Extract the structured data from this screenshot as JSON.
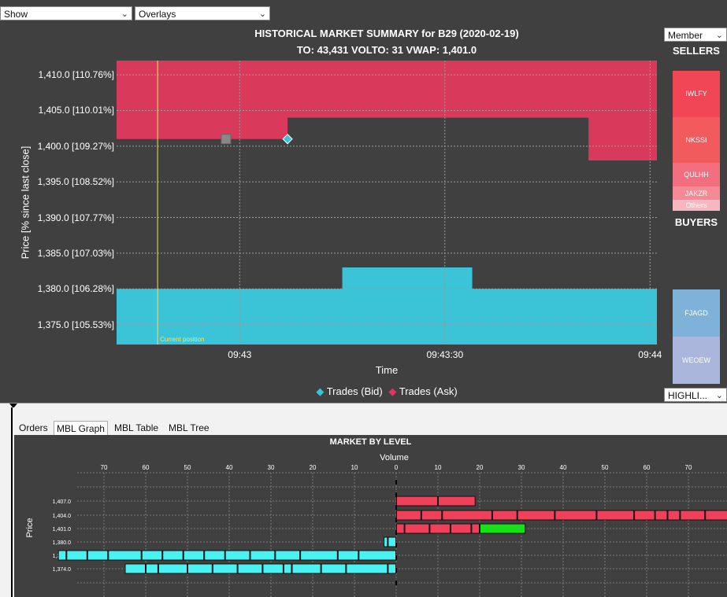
{
  "toolbar": {
    "show_label": "Show",
    "overlays_label": "Overlays"
  },
  "summary": {
    "title": "HISTORICAL MARKET SUMMARY for B29 (2020-02-19)",
    "subtitle": "TO: 43,431 VOLTO: 31 VWAP: 1,401.0",
    "ylabel": "Price [% since last close]",
    "xlabel": "Time",
    "current_position_label": "Current position",
    "legend_bid": "Trades (Bid)",
    "legend_ask": "Trades (Ask)"
  },
  "side_panel": {
    "member_label": "Member",
    "sellers_label": "SELLERS",
    "buyers_label": "BUYERS",
    "highlight_label": "HIGHLI...",
    "sellers": [
      {
        "name": "IWLFY",
        "share": 0.3,
        "color": "#f04656"
      },
      {
        "name": "NKSSI",
        "share": 0.3,
        "color": "#f25a5e"
      },
      {
        "name": "QULHH",
        "share": 0.15,
        "color": "#f36e7e"
      },
      {
        "name": "JAKZR",
        "share": 0.09,
        "color": "#f38a96"
      },
      {
        "name": "Others",
        "share": 0.07,
        "color": "#f7b7c0"
      }
    ],
    "buyers": [
      {
        "name": "FJAGD",
        "share": 0.5,
        "color": "#7fb2d8"
      },
      {
        "name": "WEOEW",
        "share": 0.5,
        "color": "#aab6dc"
      }
    ]
  },
  "tabs": [
    {
      "label": "Orders",
      "active": false
    },
    {
      "label": "MBL Graph",
      "active": true
    },
    {
      "label": "MBL Table",
      "active": false
    },
    {
      "label": "MBL Tree",
      "active": false
    }
  ],
  "chart_data": [
    {
      "type": "area",
      "title": "HISTORICAL MARKET SUMMARY for B29 (2020-02-19)",
      "subtitle": "TO: 43,431 VOLTO: 31 VWAP: 1,401.0",
      "xlabel": "Time",
      "ylabel": "Price [% since last close]",
      "xlim": [
        "09:42:42",
        "09:44:01"
      ],
      "ylim": [
        1372.2,
        1412.0
      ],
      "x_ticks": [
        "09:43",
        "09:43:30",
        "09:44"
      ],
      "y_ticks": [
        "1,410.0 [110.76%]",
        "1,405.0 [110.01%]",
        "1,400.0 [109.27%]",
        "1,395.0 [108.52%]",
        "1,390.0 [107.77%]",
        "1,385.0 [107.03%]",
        "1,380.0 [106.28%]",
        "1,375.0 [105.53%]"
      ],
      "y_tick_values": [
        1410,
        1405,
        1400,
        1395,
        1390,
        1385,
        1380,
        1375
      ],
      "grid": true,
      "legend": "bottom",
      "current_position_time": "09:42:48",
      "series": [
        {
          "name": "Trades (Bid)",
          "color": "#3bc3d8",
          "points": [
            [
              "09:42:42",
              1380.0
            ],
            [
              "09:43:15",
              1380.0
            ],
            [
              "09:43:15",
              1383.0
            ],
            [
              "09:43:34",
              1383.0
            ],
            [
              "09:43:34",
              1380.0
            ],
            [
              "09:44:01",
              1380.0
            ]
          ]
        },
        {
          "name": "Trades (Ask)",
          "color": "#d9395a",
          "points": [
            [
              "09:42:42",
              1401.0
            ],
            [
              "09:43:07",
              1401.0
            ],
            [
              "09:43:07",
              1404.0
            ],
            [
              "09:43:51",
              1404.0
            ],
            [
              "09:43:51",
              1398.0
            ],
            [
              "09:44:01",
              1398.0
            ]
          ]
        }
      ],
      "markers": [
        {
          "time": "09:42:58",
          "price": 1401.0,
          "shape": "square"
        },
        {
          "time": "09:43:07",
          "price": 1401.0,
          "shape": "diamond"
        }
      ]
    },
    {
      "type": "bar",
      "title": "MARKET BY LEVEL",
      "xlabel": "Volume",
      "ylabel": "Price",
      "xlim": [
        -76,
        76
      ],
      "x_ticks": [
        70,
        60,
        50,
        40,
        30,
        20,
        10,
        0,
        10,
        20,
        30,
        40,
        50,
        60,
        70
      ],
      "y_ticks": [
        "1,407.0",
        "1,404.0",
        "1,401.0",
        "1,380.0",
        "1,377.0",
        "1,374.0"
      ],
      "ask_color": "#f0405a",
      "bid_color": "#4af2f2",
      "highlight_color": "#16e016",
      "levels": [
        {
          "price": "1,407.0",
          "side": "ask",
          "orders": [
            10,
            9
          ]
        },
        {
          "price": "1,404.0",
          "side": "ask",
          "orders": [
            6,
            5,
            12,
            6,
            9,
            10,
            9,
            5,
            3,
            3,
            6,
            8
          ]
        },
        {
          "price": "1,401.0",
          "side": "ask",
          "orders": [
            2,
            6,
            5,
            5,
            2
          ],
          "highlight": [
            11
          ]
        },
        {
          "price": "1,380.0",
          "side": "bid",
          "orders": [
            2,
            1
          ]
        },
        {
          "price": "1,377.0",
          "side": "bid",
          "orders": [
            9,
            5,
            9,
            6,
            6,
            6,
            5,
            5,
            5,
            5,
            8,
            5,
            5,
            2
          ]
        },
        {
          "price": "1,374.0",
          "side": "bid",
          "orders": [
            2,
            10,
            6,
            7,
            2,
            5,
            6,
            6,
            6,
            7,
            3,
            5
          ]
        }
      ]
    }
  ]
}
